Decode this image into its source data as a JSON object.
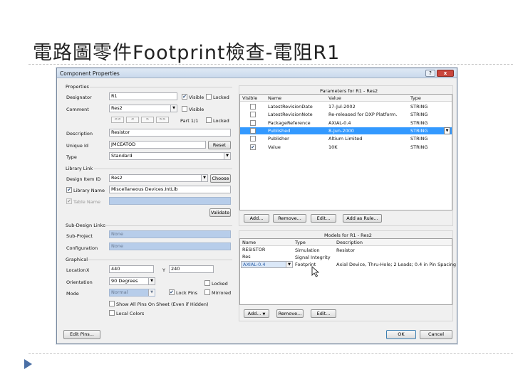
{
  "slide": {
    "title": "電路圖零件Footprint檢查-電阻R1"
  },
  "dialog": {
    "title": "Component Properties",
    "help_icon": "?",
    "close_icon": "x",
    "properties": {
      "section": "Properties",
      "designator_label": "Designator",
      "designator_value": "R1",
      "visible_label": "Visible",
      "locked_label": "Locked",
      "comment_label": "Comment",
      "comment_value": "Res2",
      "part_label": "Part 1/1",
      "nav": [
        "<<",
        "<",
        ">",
        ">>"
      ],
      "description_label": "Description",
      "description_value": "Resistor",
      "unique_id_label": "Unique Id",
      "unique_id_value": "JMCEATOD",
      "reset_label": "Reset",
      "type_label": "Type",
      "type_value": "Standard"
    },
    "library_link": {
      "section": "Library Link",
      "design_item_label": "Design Item ID",
      "design_item_value": "Res2",
      "choose_label": "Choose",
      "library_name_label": "Library Name",
      "library_name_value": "Miscellaneous Devices.IntLib",
      "table_name_label": "Table Name",
      "validate_label": "Validate"
    },
    "sub_design": {
      "section": "Sub-Design Links",
      "sub_project_label": "Sub-Project",
      "sub_project_value": "None",
      "configuration_label": "Configuration",
      "configuration_value": "None"
    },
    "graphical": {
      "section": "Graphical",
      "location_label": "Location",
      "x_label": "X",
      "x_value": "440",
      "y_label": "Y",
      "y_value": "240",
      "orientation_label": "Orientation",
      "orientation_value": "90 Degrees",
      "locked_label": "Locked",
      "mode_label": "Mode",
      "mode_value": "Normal",
      "lock_pins_label": "Lock Pins",
      "mirrored_label": "Mirrored",
      "show_all_pins_label": "Show All Pins On Sheet (Even if Hidden)",
      "local_colors_label": "Local Colors"
    },
    "parameters": {
      "title": "Parameters for R1 - Res2",
      "columns": [
        "Visible",
        "Name",
        "Value",
        "Type"
      ],
      "rows": [
        {
          "visible": false,
          "name": "LatestRevisionDate",
          "value": "17-Jul-2002",
          "type": "STRING"
        },
        {
          "visible": false,
          "name": "LatestRevisionNote",
          "value": "Re-released for DXP Platform.",
          "type": "STRING"
        },
        {
          "visible": false,
          "name": "PackageReference",
          "value": "AXIAL-0.4",
          "type": "STRING"
        },
        {
          "visible": false,
          "name": "Published",
          "value": "8-Jun-2000",
          "type": "STRING",
          "selected": true
        },
        {
          "visible": false,
          "name": "Publisher",
          "value": "Altium Limited",
          "type": "STRING"
        },
        {
          "visible": true,
          "name": "Value",
          "value": "10K",
          "type": "STRING"
        }
      ],
      "add_label": "Add...",
      "remove_label": "Remove...",
      "edit_label": "Edit...",
      "add_as_rule_label": "Add as Rule..."
    },
    "models": {
      "title": "Models for R1 - Res2",
      "columns": [
        "Name",
        "Type",
        "Description"
      ],
      "rows": [
        {
          "name": "RESISTOR",
          "type": "Simulation",
          "description": "Resistor"
        },
        {
          "name": "Res",
          "type": "Signal Integrity",
          "description": ""
        },
        {
          "name": "AXIAL-0.4",
          "type": "Footprint",
          "description": "Axial Device, Thru-Hole; 2 Leads; 0.4 in Pin Spacing",
          "selected": true
        }
      ],
      "add_label": "Add...",
      "remove_label": "Remove...",
      "edit_label": "Edit..."
    },
    "footer": {
      "edit_pins_label": "Edit Pins...",
      "ok_label": "OK",
      "cancel_label": "Cancel"
    }
  },
  "colors": {
    "selection": "#3399ff",
    "disabled_field": "#b7cdea",
    "slide_bullet": "#4a6fa5"
  }
}
